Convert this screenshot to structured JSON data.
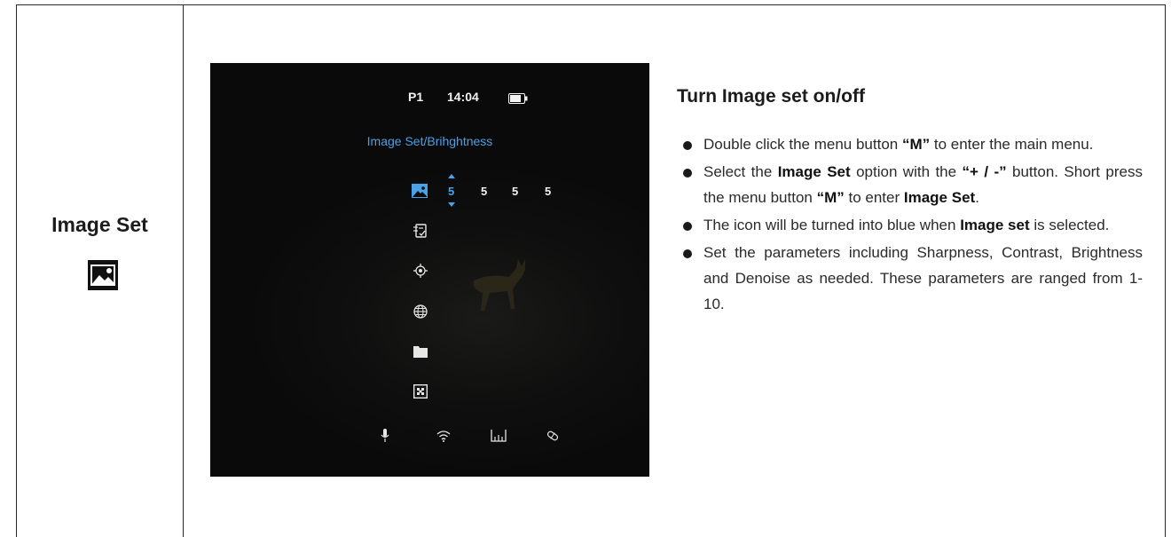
{
  "left_cell": {
    "title": "Image Set",
    "icon": "image-icon"
  },
  "screen": {
    "profile": "P1",
    "time": "14:04",
    "battery_icon": "battery-icon",
    "menu_title": "Image Set/Brihghtness",
    "values": [
      "5",
      "5",
      "5",
      "5"
    ],
    "accent_color": "#4aa1e6",
    "menu_icons": [
      "image-icon",
      "checklist-icon",
      "reticle-icon",
      "globe-icon",
      "folder-icon",
      "pixel-fix-icon"
    ],
    "status_icons": [
      "microphone-icon",
      "wifi-icon",
      "ruler-icon",
      "pill-icon"
    ]
  },
  "instructions": {
    "heading": "Turn Image set on/off",
    "bullets": [
      {
        "parts": [
          "Double click the menu button ",
          "“M”",
          " to enter the main menu."
        ]
      },
      {
        "parts": [
          "Select the ",
          "Image Set",
          " option with the ",
          "“+ / -”",
          " button. Short press the menu button ",
          "“M”",
          " to enter ",
          "Image Set",
          "."
        ]
      },
      {
        "parts": [
          "The icon will be turned into blue when ",
          "Image set",
          " is selected."
        ]
      },
      {
        "parts": [
          "Set the parameters including Sharpness, Contrast, Brightness and Denoise as needed. These parameters are ranged from 1-10."
        ]
      }
    ]
  }
}
